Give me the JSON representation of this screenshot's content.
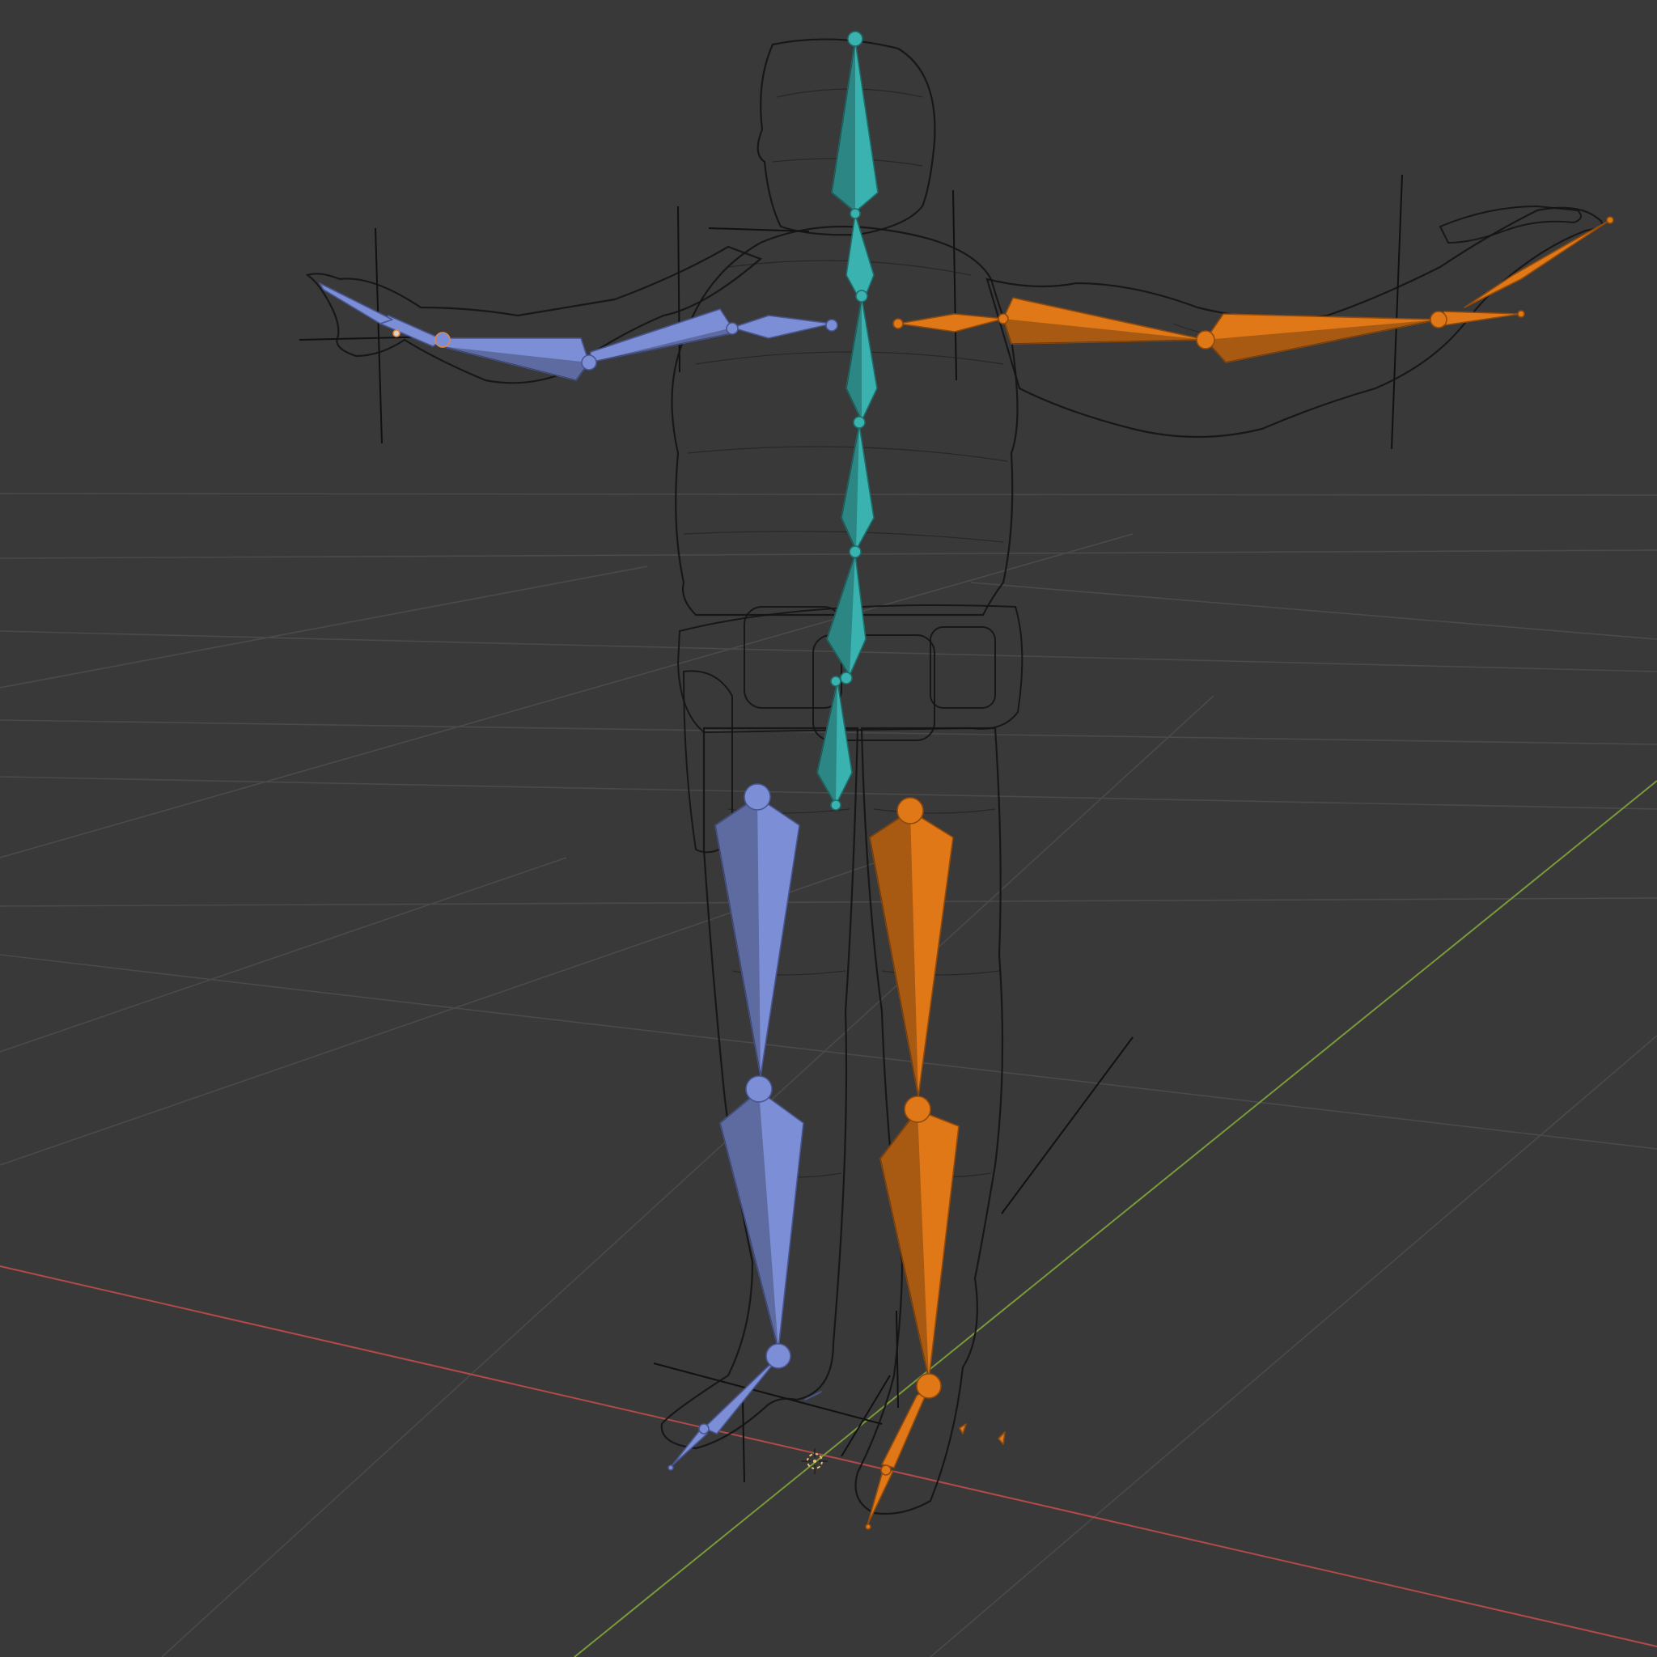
{
  "viewport": {
    "mode": "wireframe",
    "background_color": "#393939",
    "grid_color": "#4a4a4a",
    "axis_x_color": "#b24a4a",
    "axis_y_color": "#7a9a3a",
    "mesh_wire_color": "#141414"
  },
  "armature": {
    "groups": [
      {
        "name": "center",
        "color": "#3ab3b0",
        "outline": "#1f6e6b",
        "bones": [
          "head",
          "neck",
          "spine-upper",
          "spine-mid",
          "spine-lower",
          "pelvis-upper",
          "pelvis"
        ]
      },
      {
        "name": "right-side",
        "color": "#7c8fd6",
        "outline": "#4a5690",
        "bones": [
          "clavicle",
          "upper-arm",
          "forearm",
          "hand",
          "fingers",
          "thigh",
          "shin",
          "foot",
          "toe"
        ]
      },
      {
        "name": "left-side",
        "color": "#e07818",
        "outline": "#8f4a0c",
        "bones": [
          "clavicle",
          "upper-arm",
          "forearm",
          "hand",
          "fingers",
          "thigh",
          "shin",
          "foot",
          "toe"
        ]
      }
    ]
  },
  "icons": {
    "origin": "3d-cursor-icon"
  }
}
